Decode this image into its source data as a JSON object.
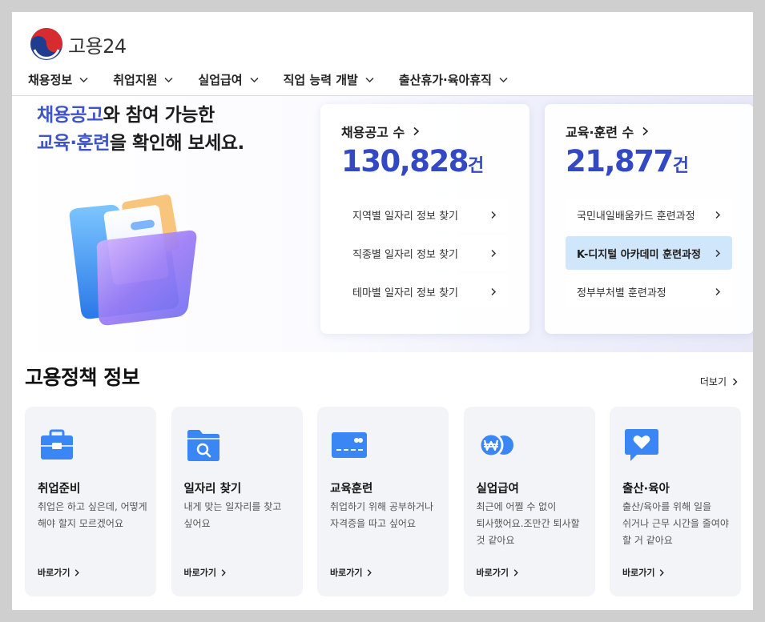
{
  "brand": {
    "name": "고용24"
  },
  "nav": {
    "items": [
      {
        "label": "채용정보"
      },
      {
        "label": "취업지원"
      },
      {
        "label": "실업급여"
      },
      {
        "label": "직업 능력 개발"
      },
      {
        "label": "출산휴가·육아휴직"
      }
    ]
  },
  "hero": {
    "line1_highlight": "채용공고",
    "line1_rest": "와 참여 가능한",
    "line2_highlight": "교육·훈련",
    "line2_rest": "을 확인해 보세요."
  },
  "stats": {
    "jobs": {
      "title": "채용공고 수",
      "value": "130,828",
      "unit": "건",
      "links": [
        {
          "label": "지역별 일자리 정보 찾기"
        },
        {
          "label": "직종별 일자리 정보 찾기"
        },
        {
          "label": "테마별 일자리 정보 찾기"
        }
      ]
    },
    "training": {
      "title": "교육·훈련 수",
      "value": "21,877",
      "unit": "건",
      "links": [
        {
          "label": "국민내일배움카드 훈련과정"
        },
        {
          "label": "K-디지털 아카데미 훈련과정"
        },
        {
          "label": "정부부처별 훈련과정"
        }
      ]
    }
  },
  "policy": {
    "title": "고용정책 정보",
    "more_label": "더보기",
    "cards": [
      {
        "icon": "briefcase-icon",
        "title": "취업준비",
        "desc": "취업은 하고 싶은데, 어떻게 해야 할지 모르겠어요",
        "go": "바로가기"
      },
      {
        "icon": "folder-search-icon",
        "title": "일자리 찾기",
        "desc": "내게 맞는 일자리를 찾고 싶어요",
        "go": "바로가기"
      },
      {
        "icon": "card-icon",
        "title": "교육훈련",
        "desc": "취업하기 위해 공부하거나 자격증을 따고 싶어요",
        "go": "바로가기"
      },
      {
        "icon": "won-coin-icon",
        "title": "실업급여",
        "desc": "최근에 어쩔 수 없이 퇴사했어요.조만간 퇴사할 것 같아요",
        "go": "바로가기"
      },
      {
        "icon": "heart-bubble-icon",
        "title": "출산·육아",
        "desc": "출산/육아를 위해 일을 쉬거나 근무 시간을 줄여야 할 거 같아요",
        "go": "바로가기"
      }
    ]
  },
  "colors": {
    "accent": "#3348c3",
    "highlight": "#3d55c9",
    "icon_blue": "#3a86f5",
    "active_link": "#cfe6fb"
  }
}
